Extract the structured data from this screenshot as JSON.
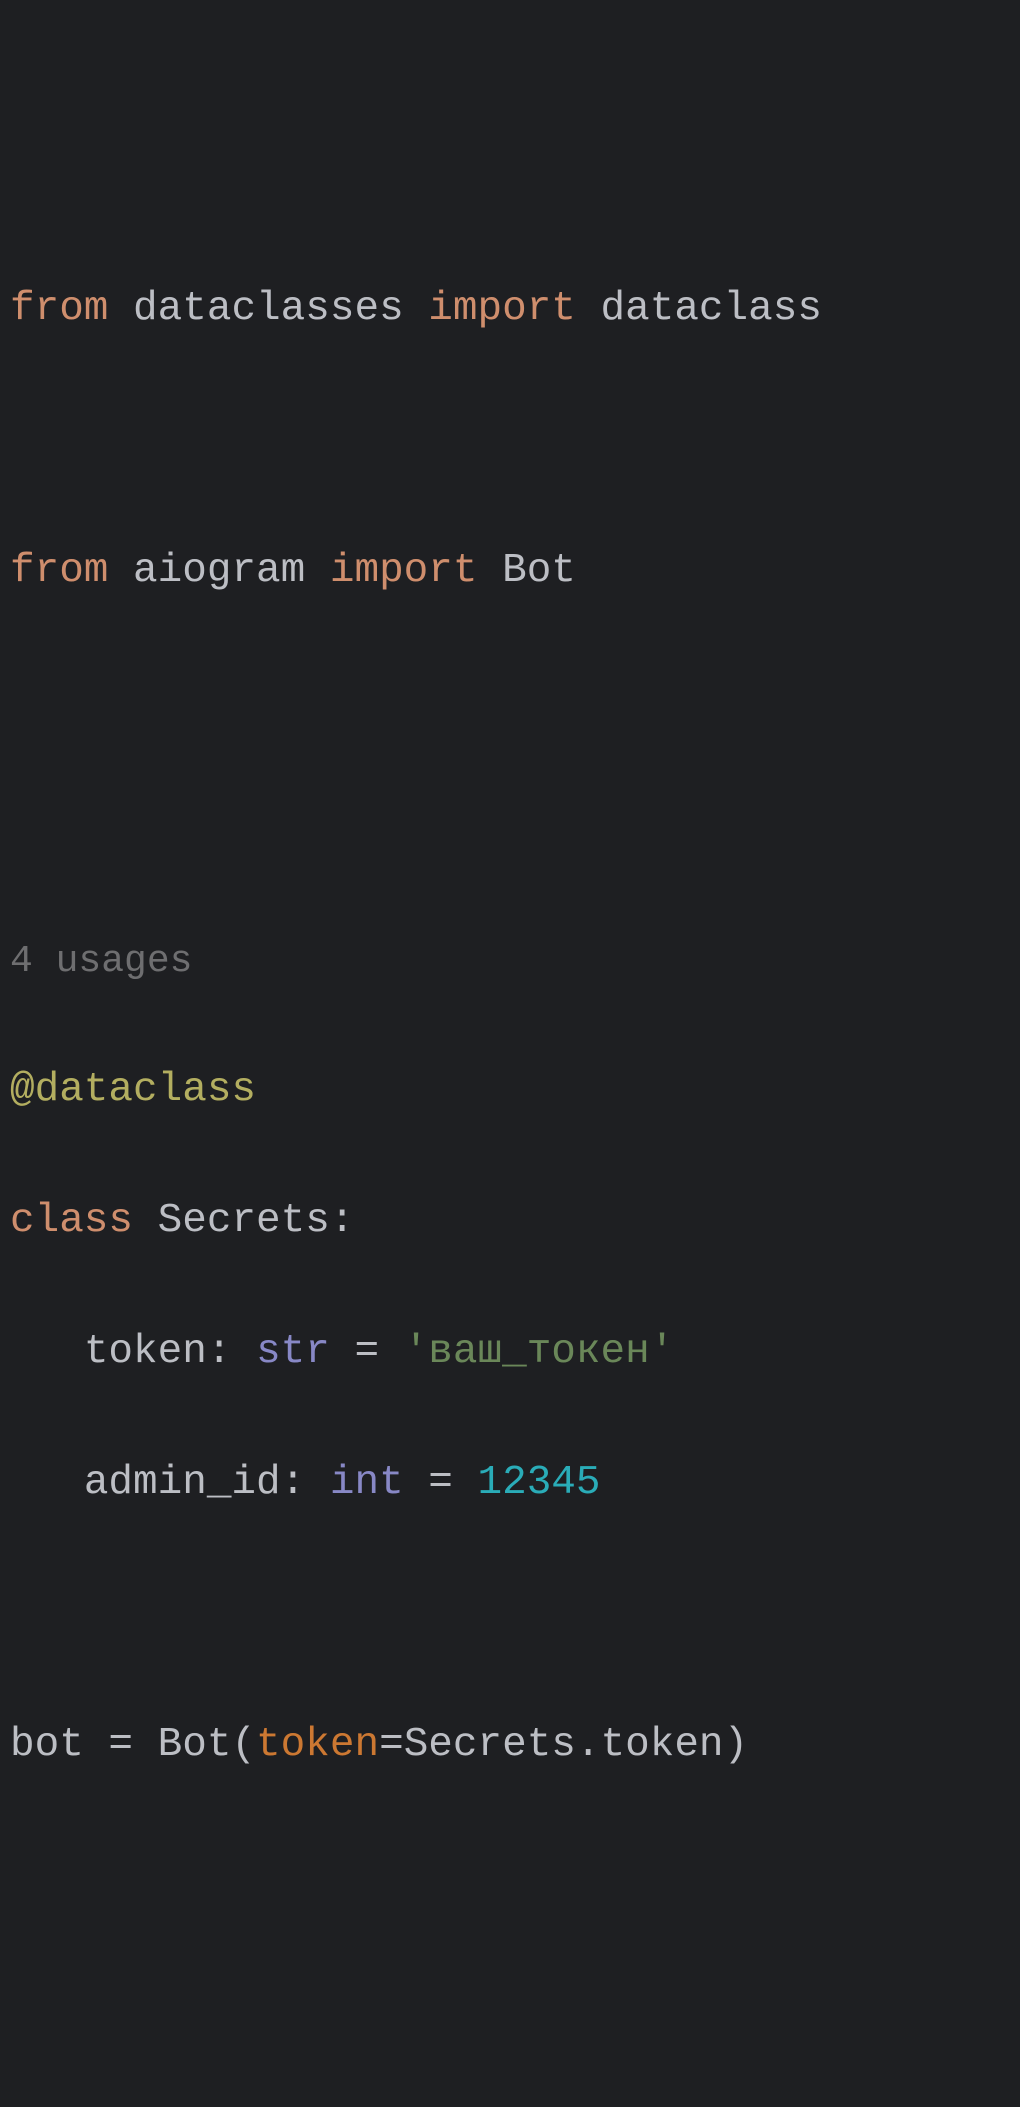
{
  "code": {
    "line1": {
      "from": "from",
      "module1": " dataclasses ",
      "import": "import",
      "name1": " dataclass"
    },
    "line2_empty": "",
    "line3": {
      "from": "from",
      "module2": " aiogram ",
      "import": "import",
      "name2": " Bot"
    },
    "line4_empty": "",
    "line5_empty": "",
    "usage_hint": "4 usages",
    "decorator": "@dataclass",
    "class_line": {
      "class_kw": "class",
      "class_name": " Secrets",
      "colon": ":"
    },
    "token_line": {
      "indent": "   ",
      "field": "token",
      "colon_space": ": ",
      "type": "str",
      "equals": " = ",
      "value": "'ваш_токен'"
    },
    "admin_line": {
      "indent": "   ",
      "field": "admin_id",
      "colon_space": ": ",
      "type": "int",
      "equals": " = ",
      "value": "12345"
    },
    "line_empty2": "",
    "bot_line": {
      "var": "bot",
      "equals": " = ",
      "call": "Bot(",
      "kwarg": "token",
      "assign": "=",
      "value": "Secrets.token)",
      "after": ""
    }
  }
}
